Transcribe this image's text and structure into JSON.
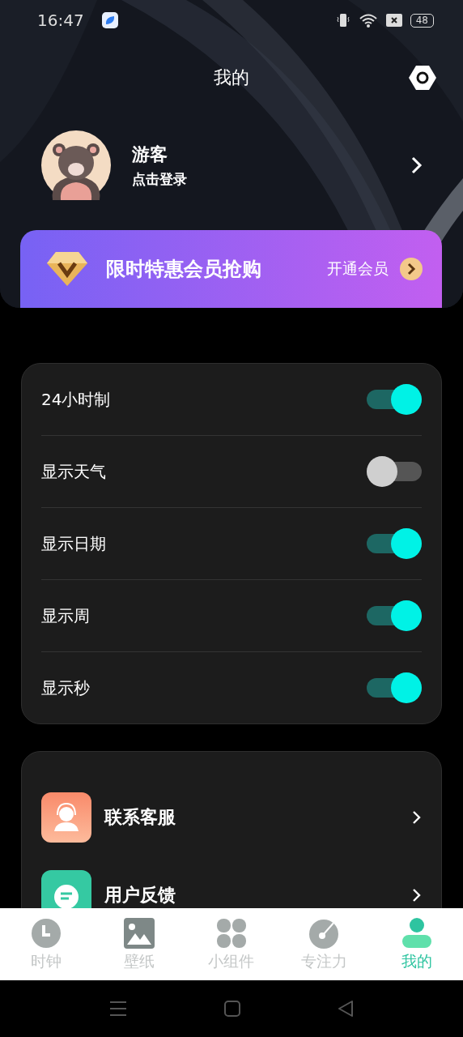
{
  "status_bar": {
    "time": "16:47",
    "battery": "48"
  },
  "header": {
    "title": "我的"
  },
  "profile": {
    "name": "游客",
    "subtitle": "点击登录"
  },
  "vip_banner": {
    "title": "限时特惠会员抢购",
    "action": "开通会员"
  },
  "settings": [
    {
      "label": "24小时制",
      "on": true
    },
    {
      "label": "显示天气",
      "on": false
    },
    {
      "label": "显示日期",
      "on": true
    },
    {
      "label": "显示周",
      "on": true
    },
    {
      "label": "显示秒",
      "on": true
    }
  ],
  "menu": [
    {
      "label": "联系客服"
    },
    {
      "label": "用户反馈"
    }
  ],
  "tabs": [
    {
      "label": "时钟",
      "selected": false
    },
    {
      "label": "壁纸",
      "selected": false
    },
    {
      "label": "小组件",
      "selected": false
    },
    {
      "label": "专注力",
      "selected": false
    },
    {
      "label": "我的",
      "selected": true
    }
  ]
}
